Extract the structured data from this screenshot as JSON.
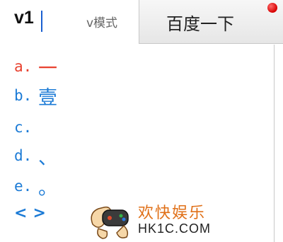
{
  "search": {
    "value": "v1",
    "mode_label": "v模式",
    "button_label": "百度一下"
  },
  "candidates": [
    {
      "index": "a.",
      "text": "一"
    },
    {
      "index": "b.",
      "text": "壹"
    },
    {
      "index": "c.",
      "text": ""
    },
    {
      "index": "d.",
      "text": "、"
    },
    {
      "index": "e.",
      "text": "。"
    }
  ],
  "pager": {
    "prev": "<",
    "next": ">"
  },
  "watermark": {
    "cn": "欢快娱乐",
    "en": "HK1C.COM"
  },
  "colors": {
    "selected": "#e8412f",
    "candidate": "#1c7bd6",
    "notify": "#d60000"
  },
  "icons": [
    "notification-dot-icon",
    "prev-page-icon",
    "next-page-icon",
    "gamepad-hands-logo"
  ]
}
